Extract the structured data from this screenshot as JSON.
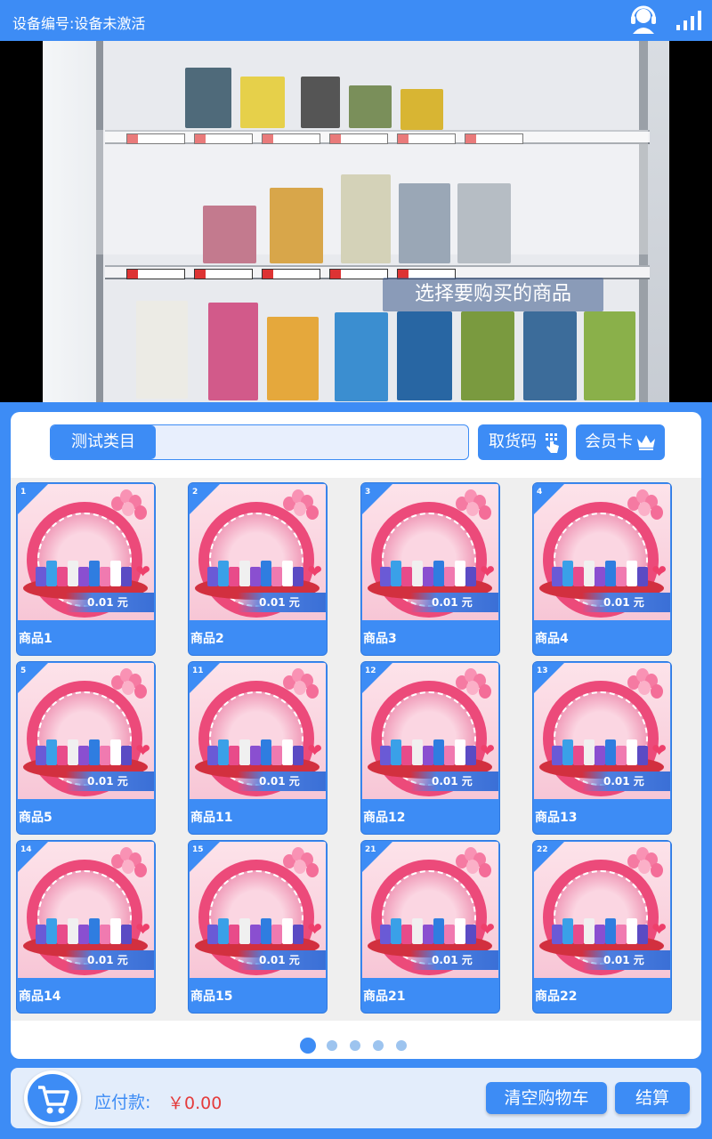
{
  "status_bar": {
    "device_label": "设备编号:设备未激活",
    "support_icon": "customer-service-headset-icon",
    "signal_icon": "signal-strength-icon"
  },
  "video": {
    "caption": "选择要购买的商品"
  },
  "toolbar": {
    "category_label": "测试类目",
    "category_input_value": "",
    "pickup_code_label": "取货码",
    "pickup_code_icon": "hand-pointer-icon",
    "member_card_label": "会员卡",
    "member_card_icon": "crown-icon"
  },
  "products": [
    {
      "slot": "1",
      "name": "商品1",
      "price": "0.01 元"
    },
    {
      "slot": "2",
      "name": "商品2",
      "price": "0.01 元"
    },
    {
      "slot": "3",
      "name": "商品3",
      "price": "0.01 元"
    },
    {
      "slot": "4",
      "name": "商品4",
      "price": "0.01 元"
    },
    {
      "slot": "5",
      "name": "商品5",
      "price": "0.01 元"
    },
    {
      "slot": "11",
      "name": "商品11",
      "price": "0.01 元"
    },
    {
      "slot": "12",
      "name": "商品12",
      "price": "0.01 元"
    },
    {
      "slot": "13",
      "name": "商品13",
      "price": "0.01 元"
    },
    {
      "slot": "14",
      "name": "商品14",
      "price": "0.01 元"
    },
    {
      "slot": "15",
      "name": "商品15",
      "price": "0.01 元"
    },
    {
      "slot": "21",
      "name": "商品21",
      "price": "0.01 元"
    },
    {
      "slot": "22",
      "name": "商品22",
      "price": "0.01 元"
    }
  ],
  "pagination": {
    "total_pages": 5,
    "current_page": 1
  },
  "bottom_bar": {
    "cart_icon": "shopping-cart-icon",
    "amount_due_label": "应付款:",
    "amount_due_value": "￥0.00",
    "clear_cart_label": "清空购物车",
    "checkout_label": "结算"
  },
  "colors": {
    "primary": "#3d8cf5",
    "price_red": "#e43b3b",
    "panel_bg": "#ffffff",
    "grid_bg": "#efefef"
  }
}
